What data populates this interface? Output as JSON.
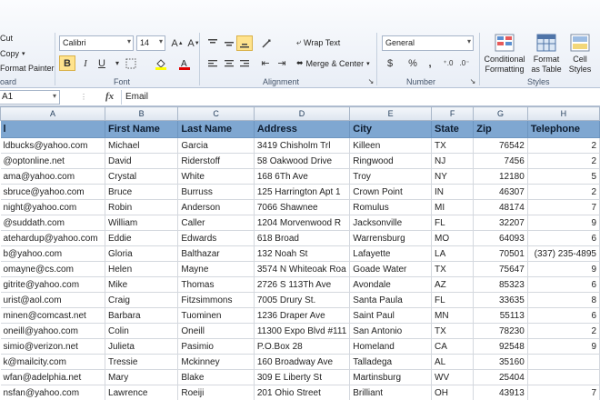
{
  "clipboard": {
    "cut": "Cut",
    "copy": "Copy",
    "format_painter": "Format Painter",
    "group_label": "oard"
  },
  "font": {
    "family": "Calibri",
    "size": "14",
    "bold": "B",
    "italic": "I",
    "underline": "U",
    "group_label": "Font"
  },
  "alignment": {
    "wrap_text": "Wrap Text",
    "merge_center": "Merge & Center",
    "group_label": "Alignment"
  },
  "number": {
    "format": "General",
    "currency": "$",
    "percent": "%",
    "comma": ",",
    "group_label": "Number"
  },
  "styles": {
    "conditional_formatting_1": "Conditional",
    "conditional_formatting_2": "Formatting",
    "format_as_table_1": "Format",
    "format_as_table_2": "as Table",
    "cell_styles_1": "Cell",
    "cell_styles_2": "Styles",
    "group_label": "Styles"
  },
  "formula_bar": {
    "name_box": "A1",
    "fx": "fx",
    "content": "Email"
  },
  "colors": {
    "header_fill": "#7fa7d1",
    "selected_button": "#ffe38d"
  },
  "columns": [
    "A",
    "B",
    "C",
    "D",
    "E",
    "F",
    "G",
    "H"
  ],
  "table_headers": [
    "l",
    "First Name",
    "Last Name",
    "Address",
    "City",
    "State",
    "Zip",
    "Telephone"
  ],
  "rows": [
    [
      "ldbucks@yahoo.com",
      "Michael",
      "Garcia",
      "3419 Chisholm Trl",
      "Killeen",
      "TX",
      "76542",
      "2"
    ],
    [
      "@optonline.net",
      "David",
      "Riderstoff",
      "58 Oakwood Drive",
      "Ringwood",
      "NJ",
      "7456",
      "2"
    ],
    [
      "ama@yahoo.com",
      "Crystal",
      "White",
      "168 6Th Ave",
      "Troy",
      "NY",
      "12180",
      "5"
    ],
    [
      "sbruce@yahoo.com",
      "Bruce",
      "Burruss",
      "125 Harrington Apt 1",
      "Crown Point",
      "IN",
      "46307",
      "2"
    ],
    [
      "night@yahoo.com",
      "Robin",
      "Anderson",
      "7066 Shawnee",
      "Romulus",
      "MI",
      "48174",
      "7"
    ],
    [
      "@suddath.com",
      "William",
      "Caller",
      "1204 Morvenwood R",
      "Jacksonville",
      "FL",
      "32207",
      "9"
    ],
    [
      "atehardup@yahoo.com",
      "Eddie",
      "Edwards",
      "618 Broad",
      "Warrensburg",
      "MO",
      "64093",
      "6"
    ],
    [
      "b@yahoo.com",
      "Gloria",
      "Balthazar",
      "132 Noah St",
      "Lafayette",
      "LA",
      "70501",
      "(337) 235-4895"
    ],
    [
      "omayne@cs.com",
      "Helen",
      "Mayne",
      "3574 N Whiteoak Roa",
      "Goade Water",
      "TX",
      "75647",
      "9"
    ],
    [
      "gitrite@yahoo.com",
      "Mike",
      "Thomas",
      "2726 S 113Th Ave",
      "Avondale",
      "AZ",
      "85323",
      "6"
    ],
    [
      "urist@aol.com",
      "Craig",
      "Fitzsimmons",
      "7005 Drury St.",
      "Santa Paula",
      "FL",
      "33635",
      "8"
    ],
    [
      "minen@comcast.net",
      "Barbara",
      "Tuominen",
      "1236 Draper Ave",
      "Saint Paul",
      "MN",
      "55113",
      "6"
    ],
    [
      "oneill@yahoo.com",
      "Colin",
      "Oneill",
      "11300 Expo Blvd #111",
      "San Antonio",
      "TX",
      "78230",
      "2"
    ],
    [
      "simio@verizon.net",
      "Julieta",
      "Pasimio",
      "P.O.Box 28",
      "Homeland",
      "CA",
      "92548",
      "9"
    ],
    [
      "k@mailcity.com",
      "Tressie",
      "Mckinney",
      "160 Broadway Ave",
      "Talladega",
      "AL",
      "35160",
      ""
    ],
    [
      "wfan@adelphia.net",
      "Mary",
      "Blake",
      "309 E Liberty St",
      "Martinsburg",
      "WV",
      "25404",
      ""
    ],
    [
      "nsfan@yahoo.com",
      "Lawrence",
      "Roeiji",
      "201 Ohio Street",
      "Brilliant",
      "OH",
      "43913",
      "7"
    ]
  ]
}
